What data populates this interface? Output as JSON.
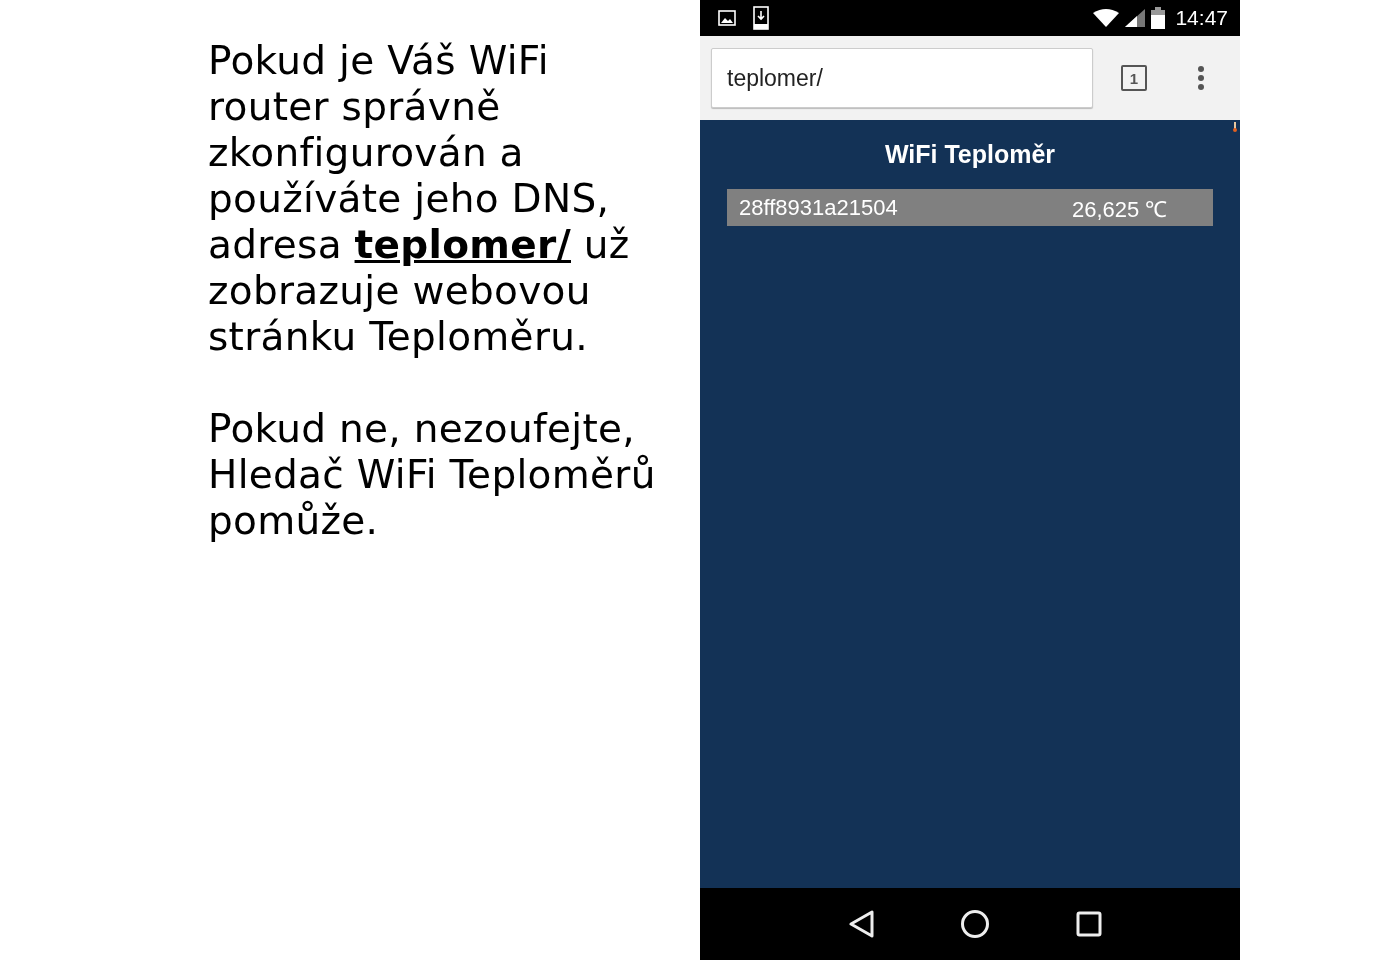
{
  "article": {
    "paragraphs": [
      "Pokud je Váš WiFi router správně zkonfigurován a používáte jeho DNS, adresa **teplomer/** už zobrazuje webovou stránku Teploměru.",
      "Pokud ne, nezoufejte, Hledač WiFi Teploměrů pomůže."
    ]
  },
  "status_bar": {
    "time": "14:47"
  },
  "browser": {
    "url": "teplomer/",
    "tab_count": "1"
  },
  "page": {
    "title": "WiFi Teploměr",
    "sensors": [
      {
        "id": "28ff8931a21504",
        "temperature": "26,625 ℃"
      }
    ]
  }
}
